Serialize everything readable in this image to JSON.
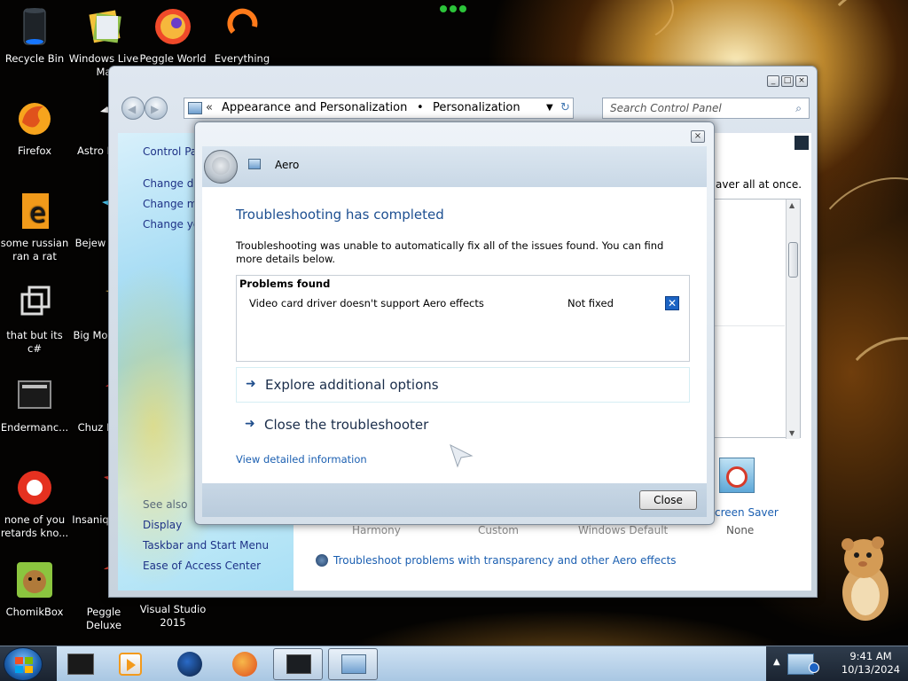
{
  "desktop": {
    "icons": [
      {
        "label": "Recycle Bin",
        "icon": "recycle-bin-icon"
      },
      {
        "label": "Windows Live Ma",
        "icon": "windows-live-icon"
      },
      {
        "label": "Peggle World",
        "icon": "peggle-world-icon"
      },
      {
        "label": "Everything",
        "icon": "everything-icon"
      },
      {
        "label": "Firefox",
        "icon": "firefox-icon"
      },
      {
        "label": "Astro Delu",
        "icon": "astro-icon"
      },
      {
        "label": "some russian ran a rat",
        "icon": "shortcut-icon"
      },
      {
        "label": "Bejew Delu",
        "icon": "bejeweled-icon"
      },
      {
        "label": "that but its c#",
        "icon": "shortcut-icon"
      },
      {
        "label": "Big Mo Delu",
        "icon": "game-icon"
      },
      {
        "label": "Endermanc...",
        "icon": "app-icon"
      },
      {
        "label": "Chuz Delu",
        "icon": "game-icon"
      },
      {
        "label": "none of you retards kno...",
        "icon": "app-icon"
      },
      {
        "label": "Insaniq Delu",
        "icon": "game-icon"
      },
      {
        "label": "ChomikBox",
        "icon": "chomikbox-icon"
      },
      {
        "label": "Peggle Deluxe",
        "icon": "peggle-deluxe-icon"
      },
      {
        "label": "Visual Studio 2015",
        "icon": "visual-studio-icon"
      }
    ]
  },
  "control_panel": {
    "breadcrumb": [
      "Appearance and Personalization",
      "Personalization"
    ],
    "breadcrumb_separator": "•",
    "search_placeholder": "Search Control Panel",
    "left_nav": {
      "home": "Control Par",
      "links": [
        "Change des",
        "Change mo",
        "Change you"
      ],
      "see_also_label": "See also",
      "see_also_links": [
        "Display",
        "Taskbar and Start Menu",
        "Ease of Access Center"
      ]
    },
    "main": {
      "partial_text": "aver all at once.",
      "themes": [
        "Harmony",
        "Custom",
        "Windows Default"
      ],
      "screen_saver_label": "creen Saver",
      "screen_saver_value": "None",
      "troubleshoot_link": "Troubleshoot problems with transparency and other Aero effects"
    }
  },
  "troubleshooter": {
    "title": "Aero",
    "heading": "Troubleshooting has completed",
    "description": "Troubleshooting was unable to automatically fix all of the issues found. You can find more details below.",
    "problems_header": "Problems found",
    "problems": [
      {
        "name": "Video card driver doesn't support Aero effects",
        "status": "Not fixed"
      }
    ],
    "options": [
      "Explore additional options",
      "Close the troubleshooter"
    ],
    "detail_link": "View detailed information",
    "close_button": "Close"
  },
  "taskbar": {
    "time": "9:41 AM",
    "date": "10/13/2024"
  },
  "colors": {
    "heading_blue": "#1d4f91",
    "link_blue": "#1b5fb1",
    "problem_x": "#1c64c4"
  }
}
